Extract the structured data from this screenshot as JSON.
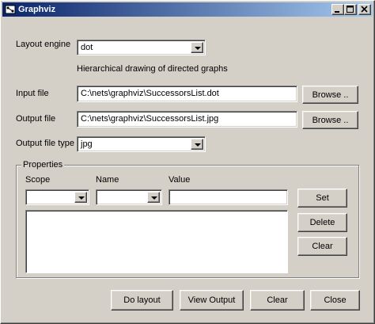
{
  "window": {
    "title": "Graphviz"
  },
  "layout_engine": {
    "label": "Layout engine",
    "value": "dot",
    "description": "Hierarchical drawing of directed graphs"
  },
  "input_file": {
    "label": "Input file",
    "value": "C:\\nets\\graphviz\\SuccessorsList.dot",
    "browse_label": "Browse .."
  },
  "output_file": {
    "label": "Output file",
    "value": "C:\\nets\\graphviz\\SuccessorsList.jpg",
    "browse_label": "Browse .."
  },
  "output_file_type": {
    "label": "Output file type",
    "value": "jpg"
  },
  "properties": {
    "group_label": "Properties",
    "scope_label": "Scope",
    "name_label": "Name",
    "value_label": "Value",
    "scope_value": "",
    "name_value": "",
    "value_value": "",
    "set_label": "Set",
    "delete_label": "Delete",
    "clear_label": "Clear"
  },
  "footer": {
    "do_layout_label": "Do layout",
    "view_output_label": "View Output",
    "clear_label": "Clear",
    "close_label": "Close"
  }
}
